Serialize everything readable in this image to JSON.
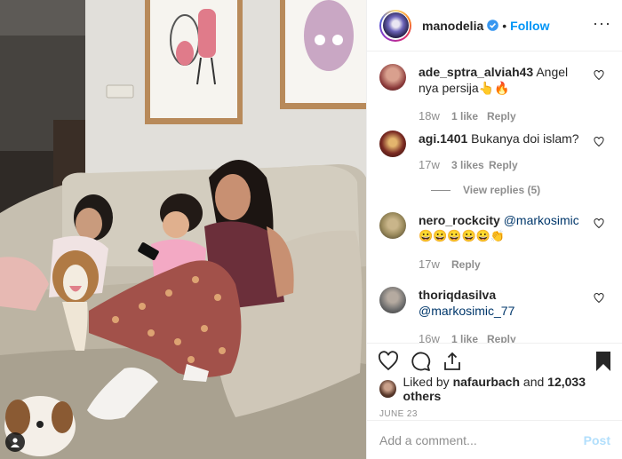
{
  "header": {
    "username": "manodelia",
    "separator": "•",
    "follow_label": "Follow",
    "more_label": "···"
  },
  "comments": [
    {
      "username": "ade_sptra_alviah43",
      "text": "Angel nya persija👆🔥",
      "time": "18w",
      "likes": "1 like",
      "reply_label": "Reply",
      "avatar_color": "#8b3a3a"
    },
    {
      "username": "agi.1401",
      "text": "Bukanya doi islam?",
      "time": "17w",
      "likes": "3 likes",
      "reply_label": "Reply",
      "view_replies": "View replies (5)",
      "avatar_color": "#7a2a22"
    },
    {
      "username": "nero_rockcity",
      "mention": "@markosimic_77",
      "emoji": "😀😀😀😀😀👏",
      "time": "17w",
      "reply_label": "Reply",
      "avatar_color": "#9a8a5c"
    },
    {
      "username": "thoriqdasilva",
      "mention": "@markosimic_77",
      "time": "16w",
      "likes": "1 like",
      "reply_label": "Reply",
      "avatar_color": "#6e6e6e"
    }
  ],
  "engagement": {
    "liked_by_prefix": "Liked by",
    "liked_by_user": "nafaurbach",
    "liked_by_and": "and",
    "others": "12,033 others",
    "date": "June 23"
  },
  "composer": {
    "placeholder": "Add a comment...",
    "post_label": "Post"
  },
  "colors": {
    "link_blue": "#0095f6",
    "post_disabled": "#b2dffc",
    "muted": "#8e8e8e",
    "text": "#262626"
  },
  "icons": [
    "heart-icon",
    "comment-icon",
    "share-icon",
    "bookmark-icon",
    "verified-badge-icon",
    "user-tag-icon"
  ]
}
